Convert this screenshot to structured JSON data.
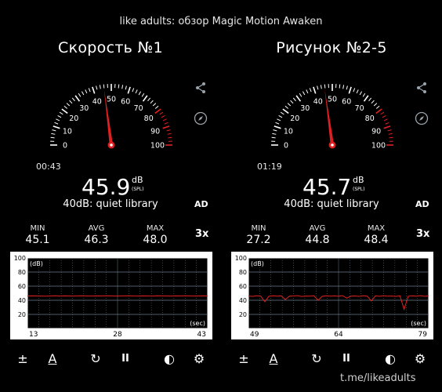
{
  "banner": "like adults: обзор Magic Motion Awaken",
  "watermark": "t.me/likeadults",
  "colors": {
    "accent": "#e02020",
    "grid": "#6b7d88",
    "graph_bg": "#ffffff"
  },
  "icons": [
    "share-icon",
    "compass-icon",
    "plus-minus-icon",
    "font-a-icon",
    "reset-icon",
    "pause-icon",
    "contrast-icon",
    "gear-icon"
  ],
  "panels": [
    {
      "title": "Скорость №1",
      "timer": "00:43",
      "reading": "45.9",
      "unit": "dB",
      "unit_sub": "(SPL)",
      "description": "40dB: quiet library",
      "ad_label": "AD",
      "stats": {
        "min_label": "MIN",
        "min": "45.1",
        "avg_label": "AVG",
        "avg": "46.3",
        "max_label": "MAX",
        "max": "48.0"
      },
      "speed": "3x",
      "gauge_value": 45.9,
      "graph": {
        "y_max_label": "100",
        "y_unit": "(dB)",
        "x_unit": "(sec)",
        "y_ticks": [
          "100",
          "80",
          "60",
          "40",
          "20"
        ],
        "x_ticks": [
          "13",
          "28",
          "43"
        ],
        "trace": [
          46,
          46.2,
          46.1,
          46,
          45.9,
          46.1,
          46.3,
          46,
          46.2,
          46.1,
          46,
          46.2,
          46.3,
          46.1,
          46,
          46.2,
          46.1,
          46.3,
          46.2,
          46,
          46.1,
          46.2,
          46.4,
          46.1,
          46,
          46.2,
          46.1,
          46,
          46.3,
          46.2,
          46.1,
          46,
          46.2,
          46.1,
          46.3,
          46.2,
          46,
          46.1,
          46.2,
          46.1
        ]
      }
    },
    {
      "title": "Рисунок №2-5",
      "timer": "01:19",
      "reading": "45.7",
      "unit": "dB",
      "unit_sub": "(SPL)",
      "description": "40dB: quiet library",
      "ad_label": "AD",
      "stats": {
        "min_label": "MIN",
        "min": "27.2",
        "avg_label": "AVG",
        "avg": "44.8",
        "max_label": "MAX",
        "max": "48.4"
      },
      "speed": "3x",
      "gauge_value": 45.7,
      "graph": {
        "y_max_label": "100",
        "y_unit": "(dB)",
        "x_unit": "(sec)",
        "y_ticks": [
          "100",
          "80",
          "60",
          "40",
          "20"
        ],
        "x_ticks": [
          "49",
          "64",
          "79"
        ],
        "trace": [
          46,
          45.6,
          46.3,
          45.9,
          38,
          45.7,
          46.4,
          45.8,
          46.2,
          41,
          45.9,
          46.1,
          46.6,
          45.4,
          46,
          45.8,
          46.3,
          40,
          45.6,
          46.4,
          45.9,
          46.2,
          45.7,
          46.5,
          43,
          45.8,
          46.1,
          45.6,
          46.3,
          45.9,
          39,
          46.2,
          45.7,
          46.4,
          45.9,
          46,
          45.5,
          46.3,
          27.2,
          45.8,
          46.2,
          45.9,
          46.6,
          45.7,
          46.1
        ]
      }
    }
  ],
  "toolbar": {
    "plus_minus": "±",
    "font_a": "A",
    "reset": "↻",
    "pause": "II",
    "contrast": "◐",
    "settings": "⚙"
  }
}
